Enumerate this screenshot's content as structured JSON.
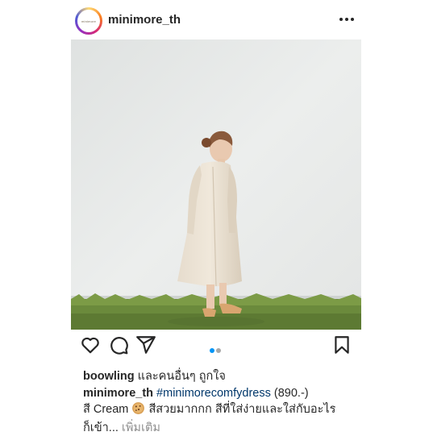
{
  "post": {
    "username": "minimore_th",
    "avatar_text": "minimore",
    "menu_icon": "more-horizontal-icon"
  },
  "actions": {
    "icons": [
      "heart-icon",
      "comment-icon",
      "share-icon",
      "bookmark-icon"
    ],
    "carousel_total": 2,
    "carousel_active": 1
  },
  "likes": {
    "user": "boowling",
    "text": "และคนอื่นๆ ถูกใจ"
  },
  "caption": {
    "username": "minimore_th",
    "hashtag": "#minimorecomfydress",
    "price": "(890.-)",
    "color_prefix": "สี Cream",
    "emoji": "cookie-emoji",
    "line2_rest": "สีสวยมากกก สีที่ใส่ง่ายและใส่กับอะไร",
    "line3": "ก็เข้า...",
    "more_label": "เพิ่มเติม"
  },
  "colors": {
    "text": "#262626",
    "hashtag": "#00376b",
    "muted": "#8e8e8e",
    "active_dot": "#0095f6"
  }
}
